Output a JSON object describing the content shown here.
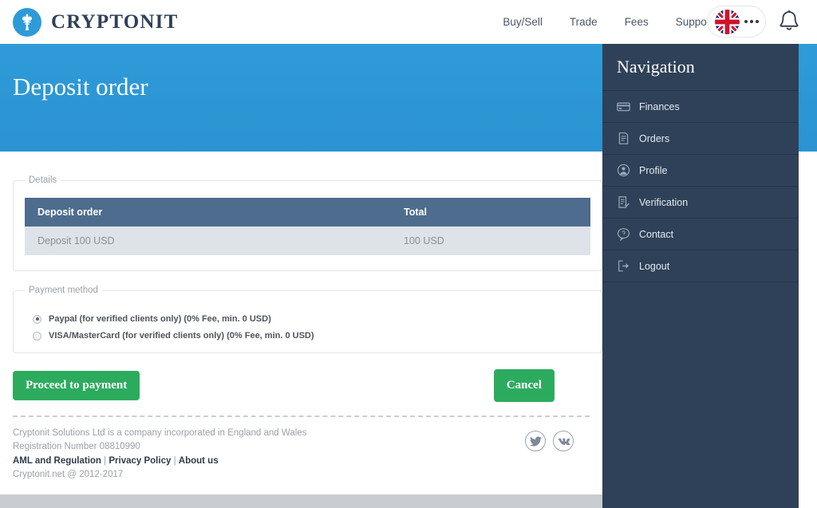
{
  "brand": {
    "name": "CRYPTONIT",
    "logo_icon": "fleur-de-lis-icon",
    "logo_color": "#2e9bd8"
  },
  "topnav": {
    "items": [
      {
        "label": "Buy/Sell"
      },
      {
        "label": "Trade"
      },
      {
        "label": "Fees"
      },
      {
        "label": "Support"
      }
    ],
    "language": {
      "icon": "uk-flag-icon",
      "more_icon": "ellipsis-icon"
    },
    "notifications": {
      "icon": "bell-icon"
    }
  },
  "hero": {
    "title": "Deposit order",
    "background_color": "#2e9bd8"
  },
  "details": {
    "legend": "Details",
    "table": {
      "headers": [
        "Deposit order",
        "Total"
      ],
      "rows": [
        [
          "Deposit 100 USD",
          "100 USD"
        ]
      ],
      "header_bg": "#4d6c8e",
      "row_bg": "#dde3e9"
    }
  },
  "payment": {
    "legend": "Payment method",
    "options": [
      {
        "label": "Paypal (for verified clients only) (0% Fee, min. 0 USD)",
        "selected": true
      },
      {
        "label": "VISA/MasterCard (for verified clients only) (0% Fee, min. 0 USD)",
        "selected": false
      }
    ]
  },
  "actions": {
    "proceed_label": "Proceed to payment",
    "cancel_label": "Cancel",
    "button_color": "#2cab5e"
  },
  "footer": {
    "line1": "Cryptonit Solutions Ltd is a company incorporated in England and Wales",
    "line2": "Registration Number 08810990",
    "links": [
      {
        "label": "AML and Regulation"
      },
      {
        "label": "Privacy Policy"
      },
      {
        "label": "About us"
      }
    ],
    "separator": "|",
    "copyright": "Cryptonit.net @ 2012-2017",
    "socials": [
      {
        "icon": "twitter-icon"
      },
      {
        "icon": "vk-icon"
      }
    ]
  },
  "navigation": {
    "title": "Navigation",
    "background_color": "#2f4158",
    "items": [
      {
        "label": "Finances",
        "icon": "credit-card-icon"
      },
      {
        "label": "Orders",
        "icon": "document-icon"
      },
      {
        "label": "Profile",
        "icon": "user-icon"
      },
      {
        "label": "Verification",
        "icon": "checklist-icon"
      },
      {
        "label": "Contact",
        "icon": "speech-bubble-icon"
      },
      {
        "label": "Logout",
        "icon": "exit-icon"
      }
    ]
  }
}
